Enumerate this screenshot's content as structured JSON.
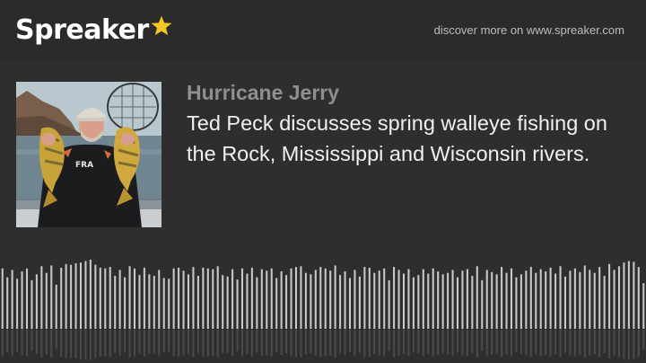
{
  "header": {
    "logo_text": "Spreaker",
    "logo_icon": "star-icon",
    "discover_link": "discover more on www.spreaker.com"
  },
  "episode": {
    "author": "Hurricane Jerry",
    "title": "Ted Peck discusses spring walleye fishing on the Rock, Mississippi and Wisconsin rivers.",
    "cover_alt": "Angler holding two perch"
  },
  "player": {
    "waveform_levels": [
      0.82,
      0.7,
      0.8,
      0.68,
      0.78,
      0.82,
      0.66,
      0.74,
      0.85,
      0.76,
      0.86,
      0.6,
      0.83,
      0.88,
      0.87,
      0.89,
      0.9,
      0.92,
      0.94,
      0.87,
      0.83,
      0.82,
      0.84,
      0.72,
      0.8,
      0.7,
      0.85,
      0.82,
      0.73,
      0.83,
      0.74,
      0.72,
      0.8,
      0.69,
      0.68,
      0.82,
      0.83,
      0.79,
      0.74,
      0.84,
      0.72,
      0.83,
      0.82,
      0.81,
      0.85,
      0.73,
      0.71,
      0.81,
      0.67,
      0.82,
      0.75,
      0.83,
      0.7,
      0.81,
      0.79,
      0.82,
      0.69,
      0.78,
      0.73,
      0.82,
      0.84,
      0.85,
      0.76,
      0.74,
      0.8,
      0.84,
      0.82,
      0.79,
      0.86,
      0.73,
      0.78,
      0.69,
      0.8,
      0.71,
      0.84,
      0.83,
      0.76,
      0.79,
      0.82,
      0.66,
      0.84,
      0.8,
      0.75,
      0.81,
      0.7,
      0.73,
      0.81,
      0.75,
      0.82,
      0.78,
      0.74,
      0.76,
      0.8,
      0.7,
      0.79,
      0.81,
      0.72,
      0.85,
      0.66,
      0.8,
      0.77,
      0.74,
      0.84,
      0.76,
      0.82,
      0.7,
      0.74,
      0.79,
      0.84,
      0.76,
      0.81,
      0.78,
      0.83,
      0.75,
      0.85,
      0.71,
      0.79,
      0.82,
      0.77,
      0.86,
      0.8,
      0.76,
      0.84,
      0.72,
      0.88,
      0.8,
      0.85,
      0.9,
      0.92,
      0.91,
      0.84,
      0.62
    ]
  },
  "colors": {
    "background": "#2e2e2e",
    "logo_star": "#f6c623",
    "author": "#8f8f8f",
    "title": "#f0f0f0",
    "waveform_bar": "#c8c8c8",
    "waveform_reflection": "#4a4a4a"
  }
}
